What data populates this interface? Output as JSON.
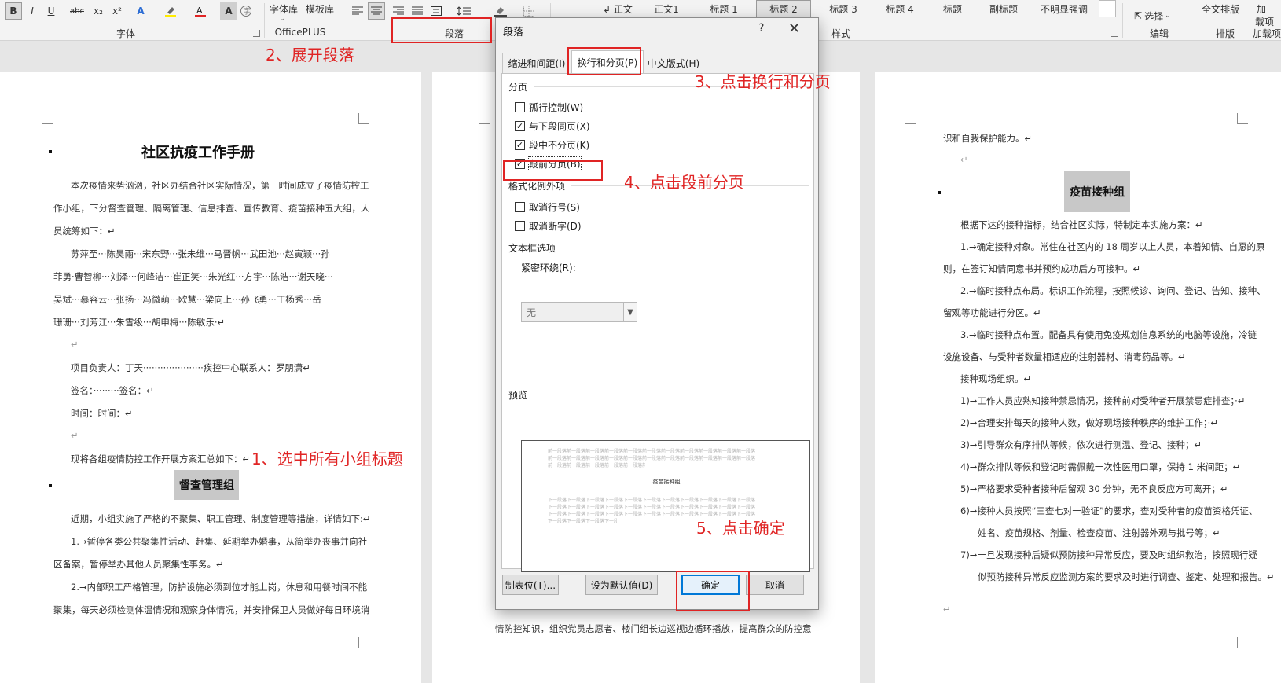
{
  "ribbon": {
    "font_buttons": [
      "B",
      "I",
      "U",
      "abc",
      "x₂",
      "x²"
    ],
    "font_group_label": "字体",
    "font_library_label": "字体库",
    "template_library_label": "模板库",
    "officeplus_label": "OfficePLUS",
    "paragraph_group_label": "段落",
    "styles": [
      "↲ 正文",
      "正文1",
      "标题 1",
      "标题 2",
      "标题 3",
      "标题 4",
      "标题",
      "副标题",
      "不明显强调"
    ],
    "styles_group_label": "样式",
    "select_label": "选择",
    "edit_group_label": "编辑",
    "full_typeset_label": "全文排版",
    "typeset_group_label": "排版",
    "add_label_1": "加",
    "add_label_2": "载项",
    "add_group_label": "加载项"
  },
  "annotations": {
    "step1": "1、选中所有小组标题",
    "step2": "2、展开段落",
    "step3": "3、点击换行和分页",
    "step4": "4、点击段前分页",
    "step5": "5、点击确定"
  },
  "page_left": {
    "title": "社区抗疫工作手册",
    "lines": [
      "本次疫情来势汹汹，社区办结合社区实际情况，第一时间成立了疫情防控工",
      "作小组，下分督查管理、隔离管理、信息排查、宣传教育、疫苗接种五大组，人",
      "员统筹如下：↵",
      "苏萍至···陈昊雨···宋东野···张未维···马晋帆···武田池···赵寅颖···孙",
      "菲勇·曹智柳···刘泽···何峰洁···崔正笑···朱光红···方宇···陈浩···谢天晓···",
      "吴斌···慕容云···张扬···冯微萌···欧慧···梁向上···孙飞勇···丁杨秀···岳",
      "珊珊···刘芳江···朱雪级···胡申梅···陈敏乐·↵",
      "↵",
      "项目负责人：丁天·····················疾控中心联系人：罗朋潇↵",
      "签名：·········签名：↵",
      "时间：时间：↵",
      "↵",
      "现将各组疫情防控工作开展方案汇总如下：↵"
    ],
    "heading": "督查管理组",
    "lines2": [
      "近期，小组实施了严格的不聚集、职工管理、制度管理等措施，详情如下:↵",
      "1.→暂停各类公共聚集性活动、赶集、延期举办婚事，从简举办丧事并向社",
      "区备案，暂停举办其他人员聚集性事务。↵",
      "2.→内部职工严格管理，防护设施必须到位才能上岗，休息和用餐时间不能",
      "聚集，每天必须检测体温情况和观察身体情况，并安排保卫人员做好每日环境消"
    ]
  },
  "page_middle": {
    "bottom_line": "情防控知识，组织党员志愿者、楼门组长边巡视边循环播放，提高群众的防控意"
  },
  "page_right": {
    "line0": "识和自我保护能力。↵",
    "line1": "↵",
    "heading": "疫苗接种组",
    "lines": [
      "根据下达的接种指标，结合社区实际，特制定本实施方案：↵",
      "1.→确定接种对象。常住在社区内的 18 周岁以上人员，本着知情、自愿的原",
      "则，在签订知情同意书并预约成功后方可接种。↵",
      "2.→临时接种点布局。标识工作流程，按照候诊、询问、登记、告知、接种、",
      "留观等功能进行分区。↵",
      "3.→临时接种点布置。配备具有使用免疫规划信息系统的电脑等设施，冷链",
      "设施设备、与受种者数量相适应的注射器材、消毒药品等。↵",
      "接种现场组织。↵",
      "1)→工作人员应熟知接种禁忌情况，接种前对受种者开展禁忌症排查；·↵",
      "2)→合理安排每天的接种人数，做好现场接种秩序的维护工作；·↵",
      "3)→引导群众有序排队等候，依次进行测温、登记、接种；↵",
      "4)→群众排队等候和登记时需佩戴一次性医用口罩，保持 1 米间距；↵",
      "5)→严格要求受种者接种后留观 30 分钟，无不良反应方可离开；↵",
      "6)→接种人员按照“三查七对一验证”的要求，查对受种者的疫苗资格凭证、",
      "姓名、疫苗规格、剂量、检查疫苗、注射器外观与批号等；↵",
      "7)→一旦发现接种后疑似预防接种异常反应，要及时组织救治，按照现行疑",
      "似预防接种异常反应监测方案的要求及时进行调查、鉴定、处理和报告。↵",
      "↵"
    ]
  },
  "dialog": {
    "title": "段落",
    "help": "?",
    "close": "✕",
    "tabs": [
      "缩进和间距(I)",
      "换行和分页(P)",
      "中文版式(H)"
    ],
    "pagination_label": "分页",
    "checkboxes": [
      {
        "label": "孤行控制(W)",
        "checked": false
      },
      {
        "label": "与下段同页(X)",
        "checked": true
      },
      {
        "label": "段中不分页(K)",
        "checked": true
      },
      {
        "label": "段前分页(B)",
        "checked": true
      }
    ],
    "format_exceptions_label": "格式化例外项",
    "exceptions": [
      {
        "label": "取消行号(S)",
        "checked": false
      },
      {
        "label": "取消断字(D)",
        "checked": false
      }
    ],
    "textbox_label": "文本框选项",
    "tight_wrap_label": "紧密环绕(R):",
    "tight_wrap_value": "无",
    "preview_label": "预览",
    "preview_prev_text": "前一段落前一段落前一段落前一段落前一段落前一段落前一段落前一段落前一段落前一段落前一段落",
    "preview_sample": "疫苗接种组",
    "preview_next_text": "下一段落下一段落下一段落下一段落下一段落下一段落下一段落下一段落下一段落下一段落下一段落",
    "buttons": {
      "tabs": "制表位(T)...",
      "default": "设为默认值(D)",
      "ok": "确定",
      "cancel": "取消"
    }
  },
  "colors": {
    "annotation_red": "#e02424",
    "heading_highlight": "#c8c8c8",
    "ok_border": "#0078d7"
  }
}
